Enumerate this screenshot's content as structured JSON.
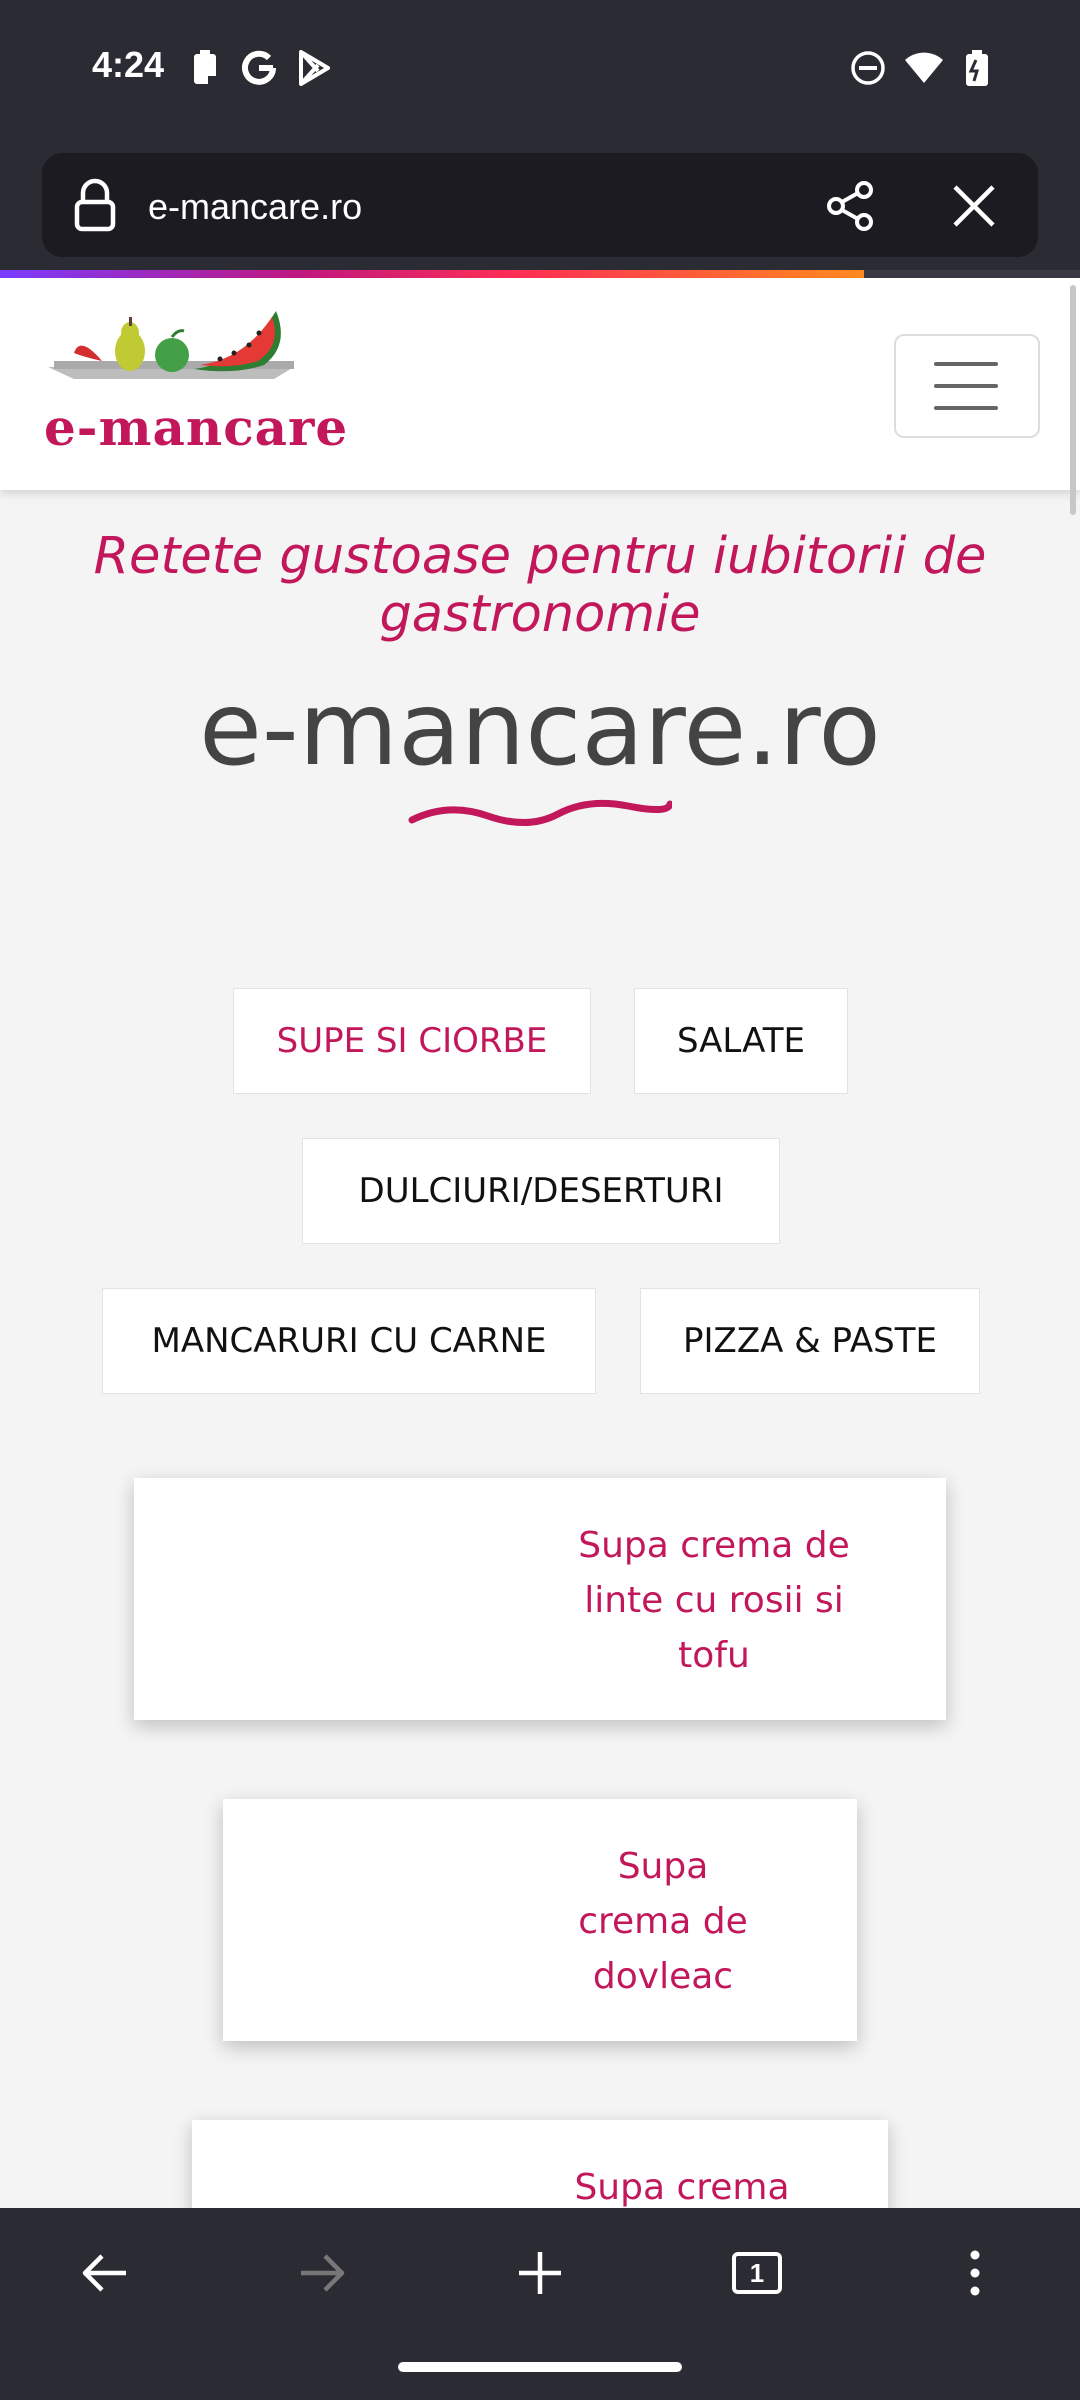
{
  "status_bar": {
    "time": "4:24",
    "left_icons": [
      "battery-saver-icon",
      "google-icon",
      "play-store-icon"
    ],
    "right_icons": [
      "dnd-icon",
      "wifi-icon",
      "battery-icon"
    ]
  },
  "browser": {
    "url": "e-mancare.ro",
    "icons": [
      "lock-icon",
      "share-icon",
      "close-icon"
    ],
    "page_load_progress": 0.8
  },
  "site": {
    "logo_text": "e-mancare",
    "tagline": "Retete gustoase pentru iubitorii de gastronomie",
    "title": "e-mancare.ro",
    "categories": [
      {
        "label": "SUPE SI CIORBE",
        "active": true
      },
      {
        "label": "SALATE",
        "active": false
      },
      {
        "label": "DULCIURI/DESERTURI",
        "active": false
      },
      {
        "label": "MANCARURI CU CARNE",
        "active": false
      },
      {
        "label": "PIZZA & PASTE",
        "active": false
      }
    ],
    "recipes": [
      {
        "title": "Supa crema de linte cu rosii si tofu"
      },
      {
        "title": "Supa crema de dovleac"
      },
      {
        "title": "Supa crema"
      }
    ]
  },
  "bottom_nav": {
    "tab_count": "1",
    "icons": [
      "back-icon",
      "forward-icon",
      "new-tab-icon",
      "tabs-icon",
      "more-menu-icon"
    ]
  },
  "colors": {
    "brand": "#c2185b",
    "chrome_dark": "#2b2b33",
    "page_bg": "#f4f4f4"
  }
}
